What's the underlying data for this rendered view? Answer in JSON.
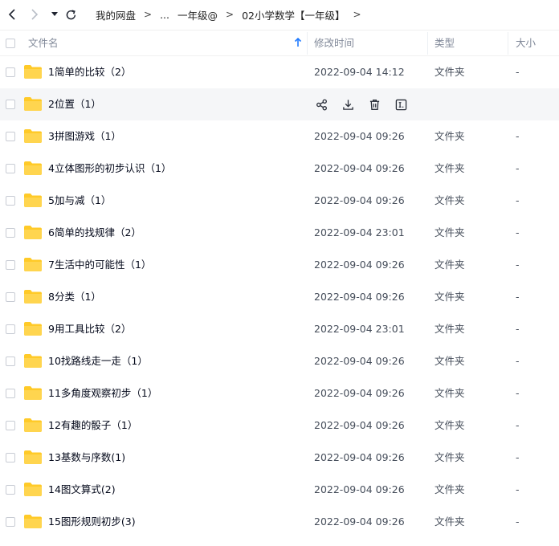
{
  "breadcrumb": [
    "我的网盘",
    "...",
    "一年级@",
    "02小学数学【一年级】"
  ],
  "columns": {
    "name": "文件名",
    "mtime": "修改时间",
    "type": "类型",
    "size": "大小"
  },
  "rows": [
    {
      "name": "1简单的比较（2）",
      "mtime": "2022-09-04 14:12",
      "type": "文件夹",
      "size": "-"
    },
    {
      "name": "2位置（1）",
      "mtime": "",
      "type": "",
      "size": ""
    },
    {
      "name": "3拼图游戏（1）",
      "mtime": "2022-09-04 09:26",
      "type": "文件夹",
      "size": "-"
    },
    {
      "name": "4立体图形的初步认识（1）",
      "mtime": "2022-09-04 09:26",
      "type": "文件夹",
      "size": "-"
    },
    {
      "name": "5加与减（1）",
      "mtime": "2022-09-04 09:26",
      "type": "文件夹",
      "size": "-"
    },
    {
      "name": "6简单的找规律（2）",
      "mtime": "2022-09-04 23:01",
      "type": "文件夹",
      "size": "-"
    },
    {
      "name": "7生活中的可能性（1）",
      "mtime": "2022-09-04 09:26",
      "type": "文件夹",
      "size": "-"
    },
    {
      "name": "8分类（1）",
      "mtime": "2022-09-04 09:26",
      "type": "文件夹",
      "size": "-"
    },
    {
      "name": "9用工具比较（2）",
      "mtime": "2022-09-04 23:01",
      "type": "文件夹",
      "size": "-"
    },
    {
      "name": "10找路线走一走（1）",
      "mtime": "2022-09-04 09:26",
      "type": "文件夹",
      "size": "-"
    },
    {
      "name": "11多角度观察初步（1）",
      "mtime": "2022-09-04 09:26",
      "type": "文件夹",
      "size": "-"
    },
    {
      "name": "12有趣的骰子（1）",
      "mtime": "2022-09-04 09:26",
      "type": "文件夹",
      "size": "-"
    },
    {
      "name": "13基数与序数(1)",
      "mtime": "2022-09-04 09:26",
      "type": "文件夹",
      "size": "-"
    },
    {
      "name": "14图文算式(2)",
      "mtime": "2022-09-04 09:26",
      "type": "文件夹",
      "size": "-"
    },
    {
      "name": "15图形规则初步(3)",
      "mtime": "2022-09-04 09:26",
      "type": "文件夹",
      "size": "-"
    }
  ]
}
